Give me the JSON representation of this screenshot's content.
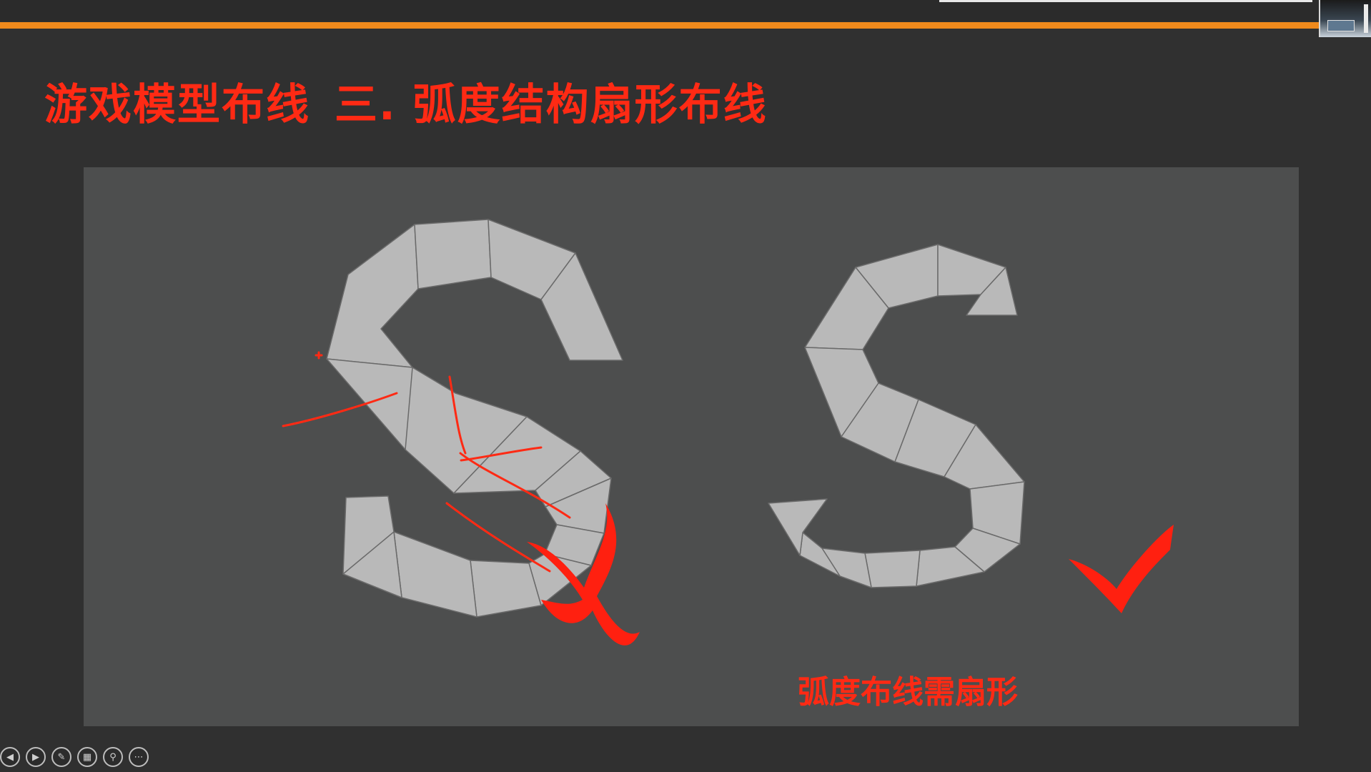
{
  "slide": {
    "title_part1": "游戏模型布线",
    "title_part2": "三. 弧度结构扇形布线",
    "caption": "弧度布线需扇形"
  },
  "colors": {
    "accent_orange": "#f08a1c",
    "title_red": "#ff2a14",
    "panel_bg": "#4d4e4e",
    "mesh_fill": "#b9b9b9"
  },
  "figures": [
    {
      "name": "wrong-wiring-s",
      "verdict": "cross-mark-icon"
    },
    {
      "name": "fan-wiring-s",
      "verdict": "check-mark-icon"
    }
  ],
  "toolbar": {
    "buttons": [
      {
        "name": "previous-slide-button",
        "icon": "◀"
      },
      {
        "name": "next-slide-button",
        "icon": "▶"
      },
      {
        "name": "pen-tool-button",
        "icon": "✎"
      },
      {
        "name": "slide-overview-button",
        "icon": "▦"
      },
      {
        "name": "zoom-button",
        "icon": "⚲"
      },
      {
        "name": "more-options-button",
        "icon": "⋯"
      }
    ]
  }
}
